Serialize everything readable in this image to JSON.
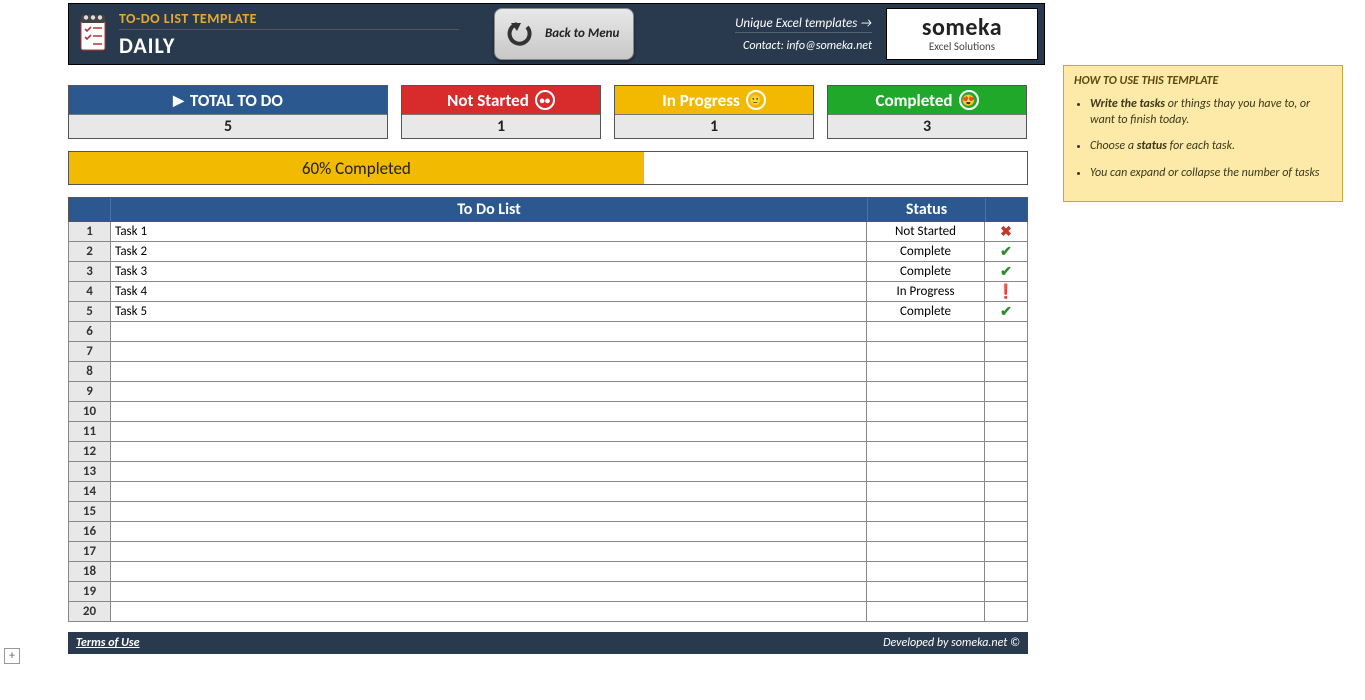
{
  "header": {
    "template_title": "TO-DO LIST TEMPLATE",
    "page_title": "DAILY",
    "back_button": "Back to Menu",
    "link_templates": "Unique Excel templates →",
    "contact": "Contact: info@someka.net",
    "logo_main": "someka",
    "logo_sub": "Excel Solutions"
  },
  "stats": {
    "total_label": "TOTAL TO DO",
    "total_value": "5",
    "not_started_label": "Not Started",
    "not_started_value": "1",
    "in_progress_label": "In Progress",
    "in_progress_value": "1",
    "completed_label": "Completed",
    "completed_value": "3"
  },
  "progress": {
    "percent": 60,
    "label": "60% Completed"
  },
  "table": {
    "header_task": "To Do List",
    "header_status": "Status",
    "rows": [
      {
        "n": "1",
        "task": "Task 1",
        "status": "Not Started",
        "icon": "x"
      },
      {
        "n": "2",
        "task": "Task 2",
        "status": "Complete",
        "icon": "check"
      },
      {
        "n": "3",
        "task": "Task 3",
        "status": "Complete",
        "icon": "check"
      },
      {
        "n": "4",
        "task": "Task 4",
        "status": "In Progress",
        "icon": "prog"
      },
      {
        "n": "5",
        "task": "Task 5",
        "status": "Complete",
        "icon": "check"
      },
      {
        "n": "6",
        "task": "",
        "status": "",
        "icon": ""
      },
      {
        "n": "7",
        "task": "",
        "status": "",
        "icon": ""
      },
      {
        "n": "8",
        "task": "",
        "status": "",
        "icon": ""
      },
      {
        "n": "9",
        "task": "",
        "status": "",
        "icon": ""
      },
      {
        "n": "10",
        "task": "",
        "status": "",
        "icon": ""
      },
      {
        "n": "11",
        "task": "",
        "status": "",
        "icon": ""
      },
      {
        "n": "12",
        "task": "",
        "status": "",
        "icon": ""
      },
      {
        "n": "13",
        "task": "",
        "status": "",
        "icon": ""
      },
      {
        "n": "14",
        "task": "",
        "status": "",
        "icon": ""
      },
      {
        "n": "15",
        "task": "",
        "status": "",
        "icon": ""
      },
      {
        "n": "16",
        "task": "",
        "status": "",
        "icon": ""
      },
      {
        "n": "17",
        "task": "",
        "status": "",
        "icon": ""
      },
      {
        "n": "18",
        "task": "",
        "status": "",
        "icon": ""
      },
      {
        "n": "19",
        "task": "",
        "status": "",
        "icon": ""
      },
      {
        "n": "20",
        "task": "",
        "status": "",
        "icon": ""
      }
    ]
  },
  "footer": {
    "terms": "Terms of Use",
    "dev": "Developed by someka.net ©"
  },
  "help": {
    "title": "HOW TO USE THIS TEMPLATE",
    "items": [
      "<b>Write the tasks</b> or things thay you have to, or want to finish today.",
      "Choose a <b>status</b> for each task.",
      "You can expand or collapse the number of tasks"
    ]
  }
}
